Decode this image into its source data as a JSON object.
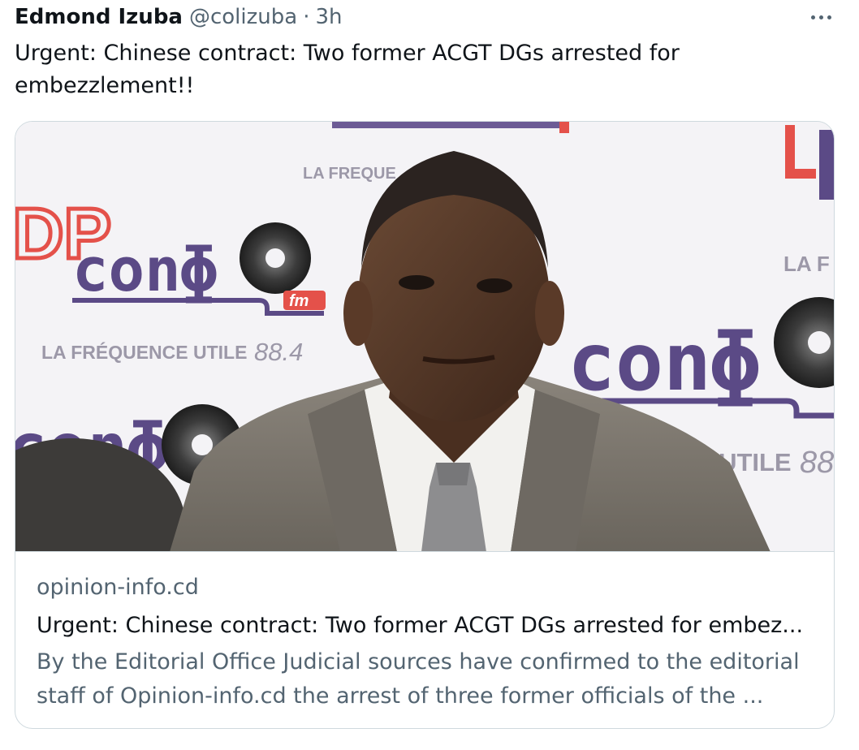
{
  "tweet": {
    "author_name": "Edmond Izuba",
    "author_handle": "@colizuba",
    "separator": "·",
    "time": "3h",
    "more_icon": "more-horizontal-icon",
    "text_line1": "Urgent: Chinese contract: Two former ACGT DGs arrested for",
    "text_line2": "embezzlement!!"
  },
  "card": {
    "domain": "opinion-info.cd",
    "title": "Urgent: Chinese contract: Two former ACGT DGs arrested for embez...",
    "description_line1": "By the Editorial Office Judicial sources have confirmed to the editorial",
    "description_line2": "staff of Opinion-info.cd the arrest of three former officials of the ...",
    "image": {
      "backdrop_logo_1": "conɸ",
      "backdrop_logo_2": "conɸ",
      "backdrop_logo_3": "conɸ",
      "backdrop_logo_prefix": "DP",
      "backdrop_small_label": "LA FREQUE",
      "backdrop_small_label_2": "LA F",
      "backdrop_tagline_1": "LA FRÉQUENCE UTILE",
      "backdrop_freq_1": "88.4",
      "backdrop_tagline_2": "NCE UTILE",
      "backdrop_freq_2": "88",
      "fm_badge": "fm"
    }
  },
  "colors": {
    "text_primary": "#0f1419",
    "text_secondary": "#536471",
    "border": "#cfd9de",
    "backdrop_purple": "#5b4a86",
    "backdrop_red": "#e4514a",
    "suit": "#7a756d"
  }
}
